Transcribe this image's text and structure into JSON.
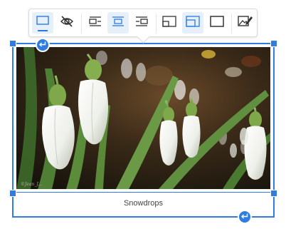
{
  "toolbar": {
    "buttons": [
      {
        "name": "toggle-caption",
        "icon": "caption-icon",
        "active": true
      },
      {
        "name": "alternative-text",
        "icon": "eye-off-icon",
        "active": false
      },
      {
        "name": "align-left-wrap",
        "icon": "align-left-wrap-icon",
        "active": false
      },
      {
        "name": "align-center",
        "icon": "align-center-icon",
        "active": true
      },
      {
        "name": "align-right-wrap",
        "icon": "align-right-wrap-icon",
        "active": false
      },
      {
        "name": "resize-small",
        "icon": "resize-small-icon",
        "active": false
      },
      {
        "name": "resize-medium",
        "icon": "resize-medium-icon",
        "active": true
      },
      {
        "name": "resize-full",
        "icon": "resize-full-icon",
        "active": false
      },
      {
        "name": "edit-image",
        "icon": "image-edit-icon",
        "active": false
      }
    ]
  },
  "image": {
    "watermark": "©Jean_J...",
    "subject_icon": "snowdrop-photo"
  },
  "caption": {
    "text": "Snowdrops"
  },
  "colors": {
    "accent": "#2f7de1",
    "icon": "#333333",
    "active_bg": "#e6f0fb"
  }
}
